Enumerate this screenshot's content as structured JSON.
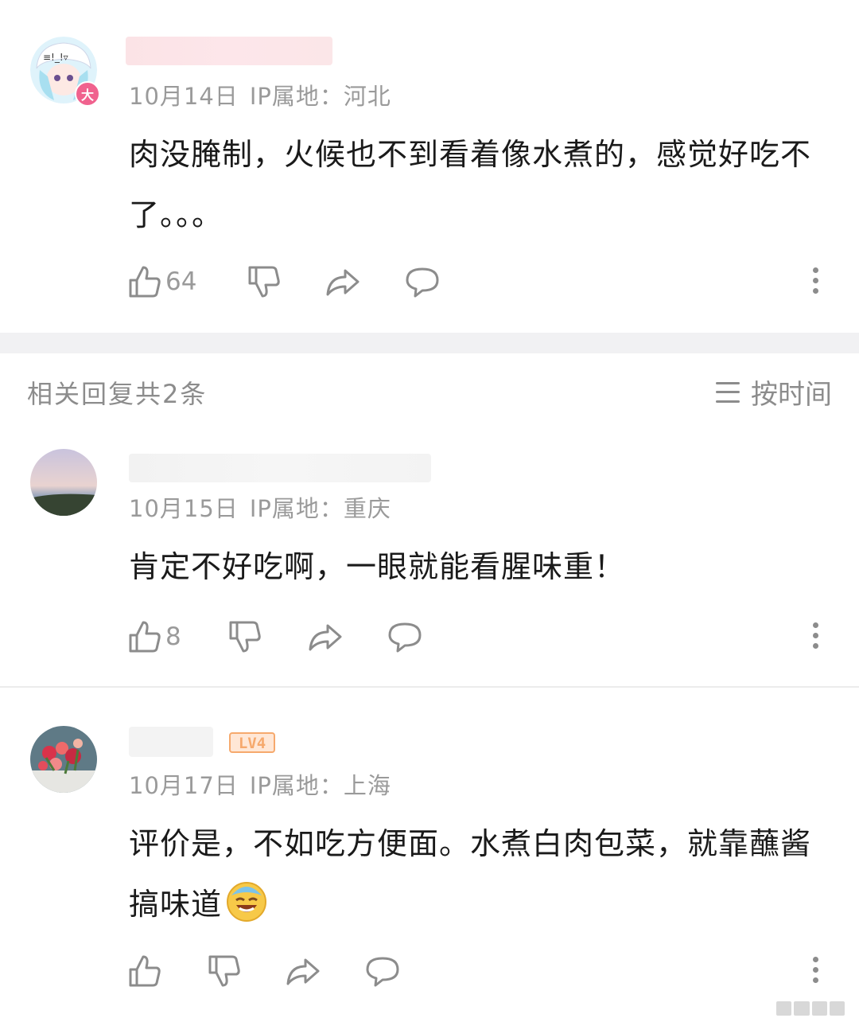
{
  "comments": [
    {
      "date": "10月14日",
      "ip": "IP属地：河北",
      "text": "肉没腌制，火候也不到看着像水煮的，感觉好吃不了。。。",
      "likes": "64",
      "avatar_badge": "大"
    }
  ],
  "replies_header": "相关回复共2条",
  "sort_label": "按时间",
  "replies": [
    {
      "date": "10月15日",
      "ip": "IP属地：重庆",
      "text": "肯定不好吃啊，一眼就能看腥味重！",
      "likes": "8"
    },
    {
      "date": "10月17日",
      "ip": "IP属地：上海",
      "text": "评价是，不如吃方便面。水煮白肉包菜，就靠蘸酱搞味道",
      "likes": "",
      "level_badge": "LV4"
    }
  ],
  "icons": {
    "like": "thumbs-up-icon",
    "dislike": "thumbs-down-icon",
    "share": "share-arrow-icon",
    "reply": "speech-bubble-icon",
    "more": "vertical-dots-icon",
    "sort": "hamburger-icon",
    "emoji": "laughing-crying-emoji-icon"
  },
  "colors": {
    "meta_text": "#9a9a9a",
    "icon": "#8c8c8c",
    "level_badge": "#f6a96d",
    "avatar_badge": "#f0628e"
  }
}
